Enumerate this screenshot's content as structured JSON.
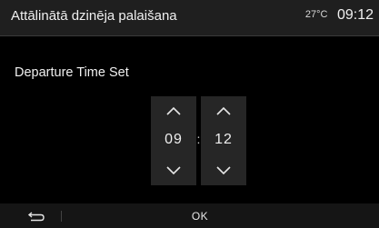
{
  "header": {
    "title": "Attālinātā dzinēja palaišana",
    "temperature": "27°C",
    "clock": "09:12"
  },
  "content": {
    "subtitle": "Departure Time Set"
  },
  "time_picker": {
    "hours": "09",
    "separator": ":",
    "minutes": "12",
    "up_icon": "chevron-up-icon",
    "down_icon": "chevron-down-icon"
  },
  "footer": {
    "back_icon": "back-arrow-icon",
    "ok_label": "OK"
  },
  "colors": {
    "background": "#000000",
    "header": "#1f1f1f",
    "picker_column": "#262626",
    "footer": "#151515",
    "text": "#f0f0f0"
  }
}
